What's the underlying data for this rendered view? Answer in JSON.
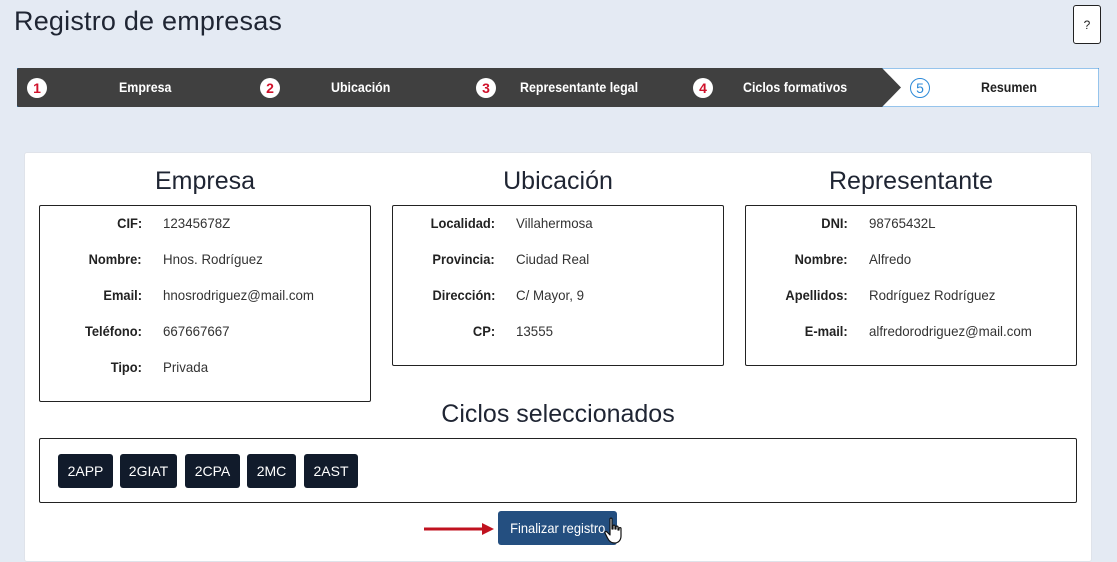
{
  "header": {
    "title": "Registro de empresas",
    "help_label": "?"
  },
  "stepper": {
    "steps": [
      {
        "num": "1",
        "label": "Empresa"
      },
      {
        "num": "2",
        "label": "Ubicación"
      },
      {
        "num": "3",
        "label": "Representante legal"
      },
      {
        "num": "4",
        "label": "Ciclos formativos"
      },
      {
        "num": "5",
        "label": "Resumen"
      }
    ],
    "active_step": "5"
  },
  "empresa": {
    "title": "Empresa",
    "fields": [
      {
        "label": "CIF:",
        "value": "12345678Z"
      },
      {
        "label": "Nombre:",
        "value": "Hnos. Rodríguez"
      },
      {
        "label": "Email:",
        "value": "hnosrodriguez@mail.com"
      },
      {
        "label": "Teléfono:",
        "value": "667667667"
      },
      {
        "label": "Tipo:",
        "value": "Privada"
      }
    ]
  },
  "ubicacion": {
    "title": "Ubicación",
    "fields": [
      {
        "label": "Localidad:",
        "value": "Villahermosa"
      },
      {
        "label": "Provincia:",
        "value": "Ciudad Real"
      },
      {
        "label": "Dirección:",
        "value": "C/ Mayor, 9"
      },
      {
        "label": "CP:",
        "value": "13555"
      }
    ]
  },
  "representante": {
    "title": "Representante",
    "fields": [
      {
        "label": "DNI:",
        "value": "98765432L"
      },
      {
        "label": "Nombre:",
        "value": "Alfredo"
      },
      {
        "label": "Apellidos:",
        "value": "Rodríguez Rodríguez"
      },
      {
        "label": "E-mail:",
        "value": "alfredorodriguez@mail.com"
      }
    ]
  },
  "ciclos": {
    "title": "Ciclos seleccionados",
    "items": [
      "2APP",
      "2GIAT",
      "2CPA",
      "2MC",
      "2AST"
    ]
  },
  "actions": {
    "finish_label": "Finalizar registro"
  },
  "colors": {
    "stepper_dark": "#404040",
    "step_number": "#d0112b",
    "active_step_accent": "#2d8ad8",
    "chip_bg": "#111b2b",
    "button_bg": "#244f80",
    "arrow": "#c0121f"
  },
  "icons": [
    "help-icon",
    "red-arrow-icon",
    "hand-pointer-cursor-icon"
  ]
}
